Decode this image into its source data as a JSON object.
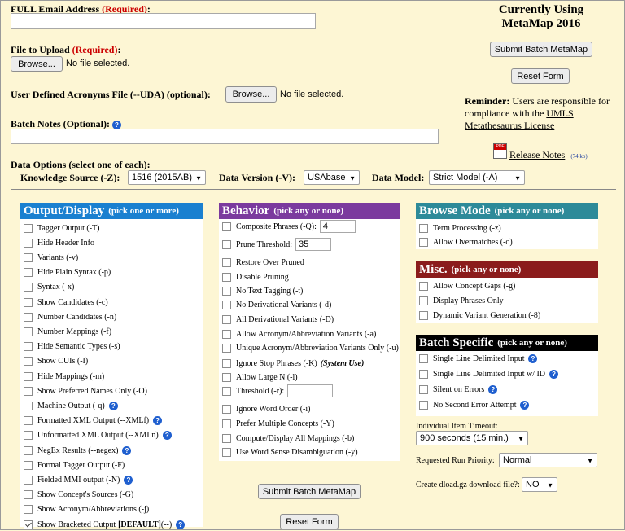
{
  "header": {
    "email_label": "FULL Email Address",
    "required": "(Required)",
    "colon": ":",
    "file_label": "File to Upload",
    "browse": "Browse...",
    "no_file": "No file selected.",
    "uda_label": "User Defined Acronyms File (--UDA) (optional):",
    "batch_notes_label": "Batch Notes (Optional):",
    "data_options_label": "Data Options (select one of each):",
    "ks_label": "Knowledge Source (-Z):",
    "ks_value": "1516 (2015AB)",
    "dv_label": "Data Version (-V):",
    "dv_value": "USAbase",
    "dm_label": "Data Model:",
    "dm_value": "Strict Model (-A)"
  },
  "right": {
    "currently_using": "Currently Using",
    "version": "MetaMap 2016",
    "submit": "Submit Batch MetaMap",
    "reset": "Reset Form",
    "reminder_bold": "Reminder:",
    "reminder_text": " Users are responsible for compliance with the ",
    "umls_link": "UMLS Metathesaurus License",
    "release_notes": "Release Notes",
    "release_size": "(74 kb)",
    "pdf_icon_label": "PDF"
  },
  "colors": {
    "page_bg": "#fdf6d4",
    "output_head": "#1a80d0",
    "behavior_head": "#7b3a9e",
    "browse_head": "#2d8a99",
    "misc_head": "#8b1c1c",
    "batch_head": "#000000"
  },
  "output": {
    "title": "Output/Display",
    "subtitle": "(pick one or more)",
    "items": [
      {
        "label": "Tagger Output (-T)",
        "checked": false
      },
      {
        "label": "Hide Header Info",
        "checked": false
      },
      {
        "label": "Variants (-v)",
        "checked": false
      },
      {
        "label": "Hide Plain Syntax (-p)",
        "checked": false
      },
      {
        "label": "Syntax (-x)",
        "checked": false
      },
      {
        "label": "Show Candidates (-c)",
        "checked": false
      },
      {
        "label": "Number Candidates (-n)",
        "checked": false
      },
      {
        "label": "Number Mappings (-f)",
        "checked": false
      },
      {
        "label": "Hide Semantic Types (-s)",
        "checked": false
      },
      {
        "label": "Show CUIs (-I)",
        "checked": false
      },
      {
        "label": "Hide Mappings (-m)",
        "checked": false
      },
      {
        "label": "Show Preferred Names Only (-O)",
        "checked": false
      },
      {
        "label": "Machine Output (-q)",
        "checked": false,
        "help": true
      },
      {
        "label": "Formatted XML Output (--XMLf)",
        "checked": false,
        "help": true
      },
      {
        "label": "Unformatted XML Output (--XMLn)",
        "checked": false,
        "help": true
      },
      {
        "label": "NegEx Results (--negex)",
        "checked": false,
        "help": true
      },
      {
        "label": "Formal Tagger Output (-F)",
        "checked": false
      },
      {
        "label": "Fielded MMI output (-N)",
        "checked": false,
        "help": true
      },
      {
        "label": "Show Concept's Sources (-G)",
        "checked": false
      },
      {
        "label": "Show Acronym/Abbreviations (-j)",
        "checked": false
      },
      {
        "label": "Show Bracketed Output",
        "bold_suffix": "[DEFAULT]",
        "suffix": " (--)",
        "checked": true,
        "help": true
      }
    ]
  },
  "behavior": {
    "title": "Behavior",
    "subtitle": "(pick any or none)",
    "items": [
      {
        "label": "Composite Phrases (-Q):",
        "checked": false,
        "input": "4"
      },
      {
        "label": "Prune Threshold:",
        "checked": false,
        "input": "35"
      },
      {
        "label": "Restore Over Pruned",
        "checked": false
      },
      {
        "label": "Disable Pruning",
        "checked": false
      },
      {
        "label": "No Text Tagging (-t)",
        "checked": false
      },
      {
        "label": "No Derivational Variants (-d)",
        "checked": false
      },
      {
        "label": "All Derivational Variants (-D)",
        "checked": false
      },
      {
        "label": "Allow Acronym/Abbreviation Variants (-a)",
        "checked": false
      },
      {
        "label": "Unique Acronym/Abbreviation Variants Only (-u)",
        "checked": false
      },
      {
        "label": "Ignore Stop Phrases (-K)",
        "italic_suffix": "(System Use)",
        "checked": false
      },
      {
        "label": "Allow Large N (-l)",
        "checked": false
      },
      {
        "label": "Threshold (-r):",
        "checked": false,
        "input": ""
      },
      {
        "label": "Ignore Word Order (-i)",
        "checked": false
      },
      {
        "label": "Prefer Multiple Concepts (-Y)",
        "checked": false
      },
      {
        "label": "Compute/Display All Mappings (-b)",
        "checked": false
      },
      {
        "label": "Use Word Sense Disambiguation (-y)",
        "checked": false
      }
    ],
    "submit": "Submit Batch MetaMap",
    "reset": "Reset Form"
  },
  "browse": {
    "title": "Browse Mode",
    "subtitle": "(pick any or none)",
    "items": [
      {
        "label": "Term Processing (-z)",
        "checked": false
      },
      {
        "label": "Allow Overmatches (-o)",
        "checked": false
      }
    ]
  },
  "misc": {
    "title": "Misc.",
    "subtitle": "(pick any or none)",
    "items": [
      {
        "label": "Allow Concept Gaps (-g)",
        "checked": false
      },
      {
        "label": "Display Phrases Only",
        "checked": false
      },
      {
        "label": "Dynamic Variant Generation (-8)",
        "checked": false
      }
    ]
  },
  "batch": {
    "title": "Batch Specific",
    "subtitle": "(pick any or none)",
    "items": [
      {
        "label": "Single Line Delimited Input",
        "checked": false,
        "help": true
      },
      {
        "label": "Single Line Delimited Input w/ ID",
        "checked": false,
        "help": true
      },
      {
        "label": "Silent on Errors",
        "checked": false,
        "help": true
      },
      {
        "label": "No Second Error Attempt",
        "checked": false,
        "help": true
      }
    ],
    "timeout_label": "Individual Item Timeout:",
    "timeout_value": "900 seconds (15 min.)",
    "priority_label": "Requested Run Priority:",
    "priority_value": "Normal",
    "dload_label": "Create dload.gz download file?:",
    "dload_value": "NO"
  }
}
